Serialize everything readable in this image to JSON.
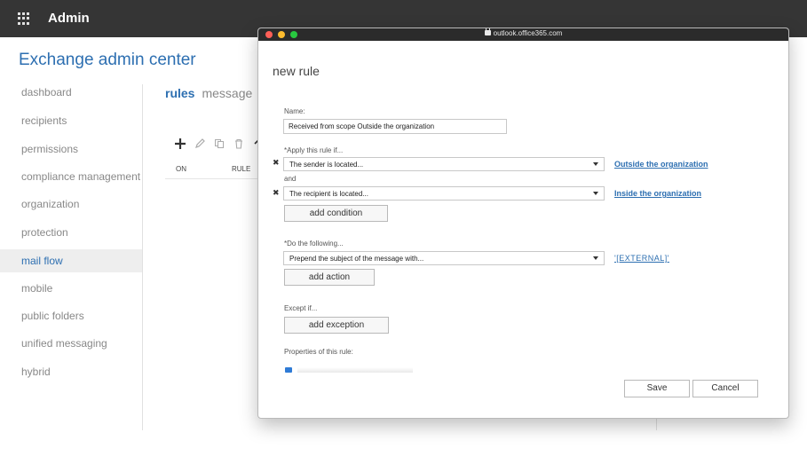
{
  "header": {
    "title": "Admin"
  },
  "eac": {
    "title": "Exchange admin center"
  },
  "sidebar": {
    "items": [
      {
        "label": "dashboard"
      },
      {
        "label": "recipients"
      },
      {
        "label": "permissions"
      },
      {
        "label": "compliance management"
      },
      {
        "label": "organization"
      },
      {
        "label": "protection"
      },
      {
        "label": "mail flow",
        "active": true
      },
      {
        "label": "mobile"
      },
      {
        "label": "public folders"
      },
      {
        "label": "unified messaging"
      },
      {
        "label": "hybrid"
      }
    ]
  },
  "content": {
    "tab_rules": "rules",
    "tab_message": "message",
    "columns": {
      "on": "ON",
      "rule": "RULE"
    },
    "toolbar_icons": [
      "plus-icon",
      "pencil-icon",
      "copy-icon",
      "trash-icon",
      "arrow-up-icon"
    ]
  },
  "popup": {
    "url": "outlook.office365.com",
    "heading": "new rule",
    "name_label": "Name:",
    "name_value": "Received from scope Outside the organization",
    "apply_label": "*Apply this rule if...",
    "condition1": "The sender is located...",
    "condition1_value": "Outside the organization",
    "and_label": "and",
    "condition2": "The recipient is located...",
    "condition2_value": "Inside the organization",
    "add_condition": "add condition",
    "do_label": "*Do the following...",
    "action": "Prepend the subject of the message with...",
    "action_value": "'[EXTERNAL]'",
    "add_action": "add action",
    "except_label": "Except if...",
    "add_exception": "add exception",
    "properties_label": "Properties of this rule:",
    "save": "Save",
    "cancel": "Cancel",
    "remove_glyph": "✖"
  },
  "colors": {
    "accent": "#2d6fb1",
    "header": "#353535",
    "active_bg": "#eeeeee"
  }
}
